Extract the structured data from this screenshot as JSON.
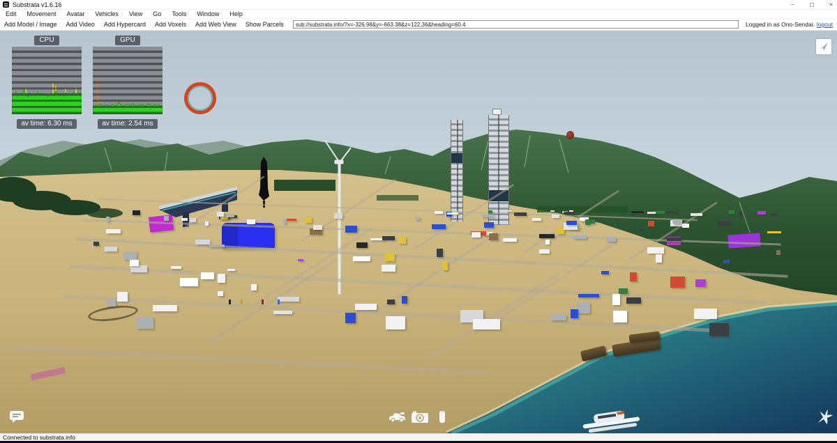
{
  "window": {
    "title": "Substrata v1.6.16",
    "minimize": "–",
    "maximize": "□",
    "close": "✕"
  },
  "menu": [
    "Edit",
    "Movement",
    "Avatar",
    "Vehicles",
    "View",
    "Go",
    "Tools",
    "Window",
    "Help"
  ],
  "toolbar": {
    "buttons": [
      "Add Model / Image",
      "Add Video",
      "Add Hypercard",
      "Add Voxels",
      "Add Web View",
      "Show Parcels"
    ],
    "url": "sub://substrata.info/?x=-326.98&y=-663.38&z=122.36&heading=60.4",
    "login_status": "Logged in as Ono-Sendai.",
    "logout": "logout"
  },
  "perf": {
    "cpu": {
      "label": "CPU",
      "av_time": "av time: 6.30 ms",
      "series": [
        0.3,
        0.28,
        0.33,
        0.27,
        0.31,
        0.29,
        0.36,
        0.3,
        0.26,
        0.32,
        0.28,
        0.3,
        0.27,
        0.33,
        0.29,
        0.31,
        0.28,
        0.3,
        0.26,
        0.29,
        0.31,
        0.27,
        0.34,
        0.3,
        0.28,
        0.31,
        0.27,
        0.32,
        0.29,
        0.31,
        0.28,
        0.33,
        0.3,
        0.29,
        0.32,
        0.3
      ],
      "spikes": [
        {
          "x": 0.2,
          "h": 0.38
        },
        {
          "x": 0.59,
          "h": 0.46
        },
        {
          "x": 0.63,
          "h": 0.42
        },
        {
          "x": 0.77,
          "h": 0.38
        },
        {
          "x": 0.92,
          "h": 0.4
        }
      ]
    },
    "gpu": {
      "label": "GPU",
      "av_time": "av time: 2.54 ms",
      "series": [
        0.13,
        0.12,
        0.14,
        0.13,
        0.15,
        0.12,
        0.13,
        0.14,
        0.12,
        0.13,
        0.15,
        0.13,
        0.12,
        0.18,
        0.14,
        0.12,
        0.13,
        0.15,
        0.14,
        0.12,
        0.16,
        0.13,
        0.12,
        0.14,
        0.13,
        0.15,
        0.12,
        0.13,
        0.16,
        0.13,
        0.12,
        0.15,
        0.13,
        0.14,
        0.12,
        0.13
      ],
      "spikes": [
        {
          "x": 0.07,
          "h": 0.52
        }
      ]
    }
  },
  "statusbar": "Connected to substrata.info",
  "colors": {
    "accent_link": "#2a5bd7",
    "sky_top": "#b6c4cf",
    "sky_bottom": "#d0dde5",
    "sand_light": "#d2be88",
    "sand_dark": "#b5a069",
    "water_shallow": "#45a49b",
    "water_deep": "#14395c",
    "mountain_light": "#3f6b43",
    "mountain_dark": "#20411f",
    "graph_green": "#2ed321",
    "graph_bg": "#8a8d91",
    "spike_yellow": "#d8c33c",
    "spike_orange": "#d8813a",
    "badge_bg": "rgba(62,66,74,0.78)"
  }
}
